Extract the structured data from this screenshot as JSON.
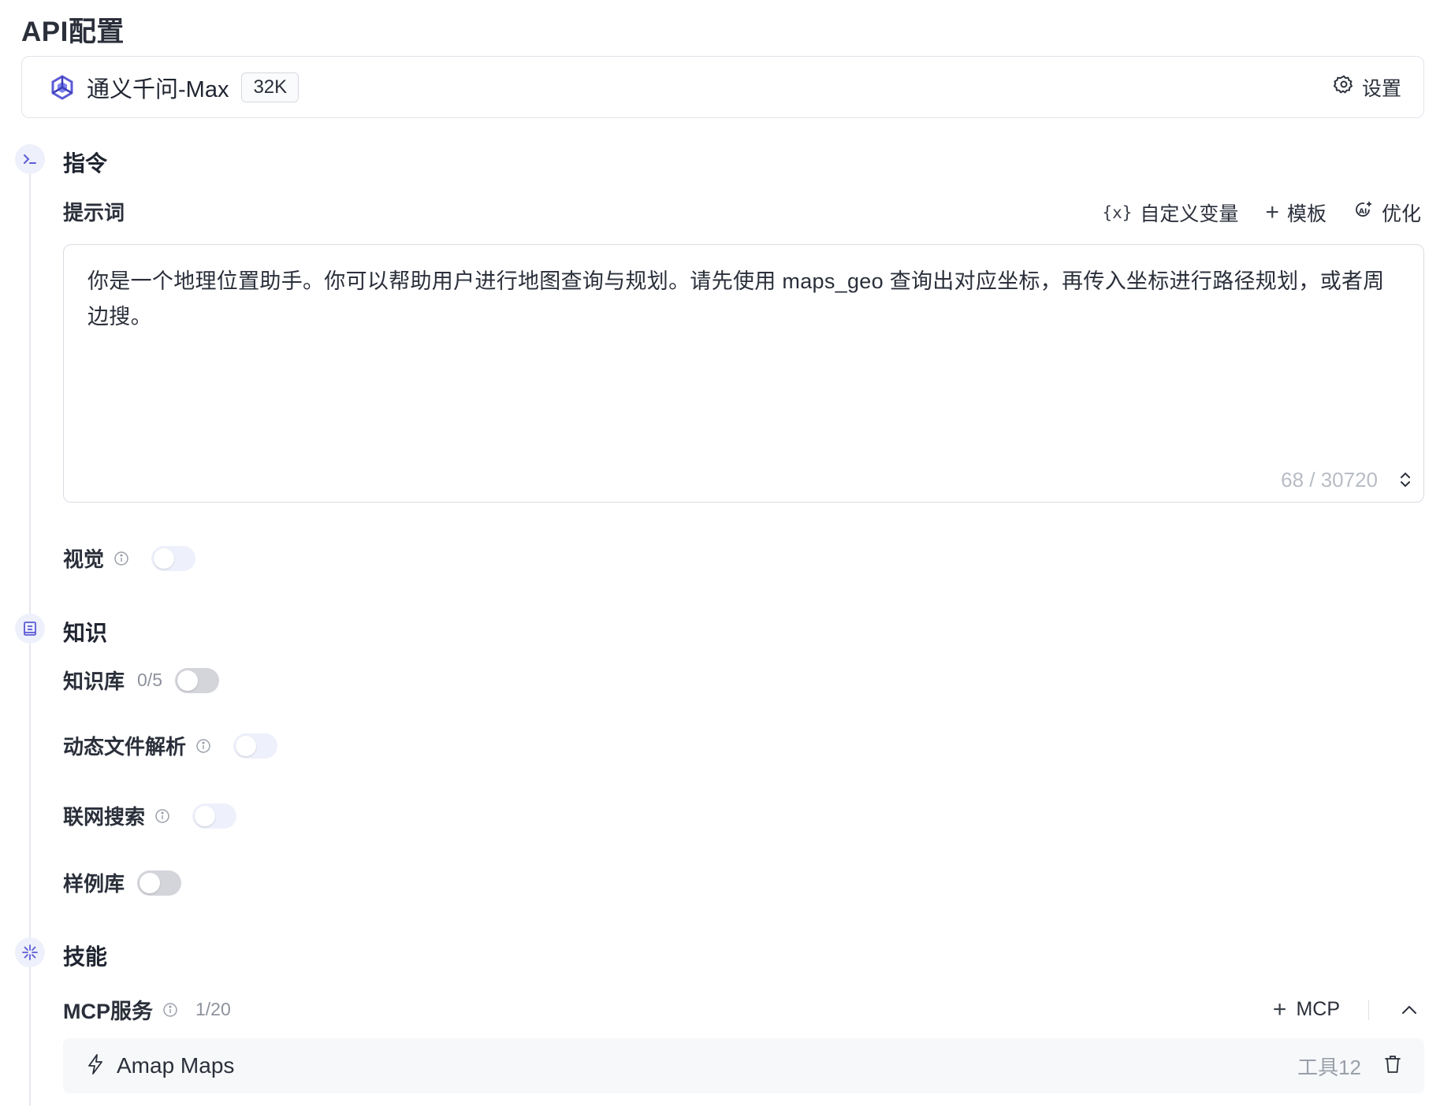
{
  "page": {
    "title": "API配置"
  },
  "model": {
    "name": "通义千问-Max",
    "context": "32K",
    "settings_label": "设置"
  },
  "instruction": {
    "section_title": "指令",
    "prompt_label": "提示词",
    "actions": {
      "variables": "自定义变量",
      "variables_glyph": "{x}",
      "template": "模板",
      "optimize": "优化"
    },
    "prompt_text": "你是一个地理位置助手。你可以帮助用户进行地图查询与规划。请先使用 maps_geo 查询出对应坐标，再传入坐标进行路径规划，或者周边搜。",
    "char_count": "68 / 30720",
    "vision": {
      "label": "视觉",
      "enabled": false
    }
  },
  "knowledge": {
    "section_title": "知识",
    "knowledge_base": {
      "label": "知识库",
      "count": "0/5",
      "enabled": false
    },
    "dynamic_file": {
      "label": "动态文件解析",
      "enabled": false
    },
    "web_search": {
      "label": "联网搜索",
      "enabled": false
    },
    "examples": {
      "label": "样例库",
      "enabled": false
    }
  },
  "skills": {
    "section_title": "技能",
    "mcp": {
      "label": "MCP服务",
      "count": "1/20",
      "add_label": "MCP"
    },
    "items": [
      {
        "name": "Amap Maps",
        "tools": "工具12"
      }
    ]
  },
  "icons": {
    "model_logo": "qwen-logo-icon",
    "settings": "gear-icon",
    "instruction": "terminal-icon",
    "knowledge": "book-icon",
    "skills": "sparkle-icon",
    "info": "info-icon",
    "optimize": "ai-sparkle-icon",
    "resize": "chevron-updown-icon",
    "collapse": "chevron-up-icon",
    "mcp_item": "lightning-icon",
    "delete": "trash-icon"
  },
  "colors": {
    "accent": "#5b5bd6",
    "icon_bg": "#eef0fb",
    "border": "#e1e4ea",
    "muted_text": "#8d929c"
  }
}
